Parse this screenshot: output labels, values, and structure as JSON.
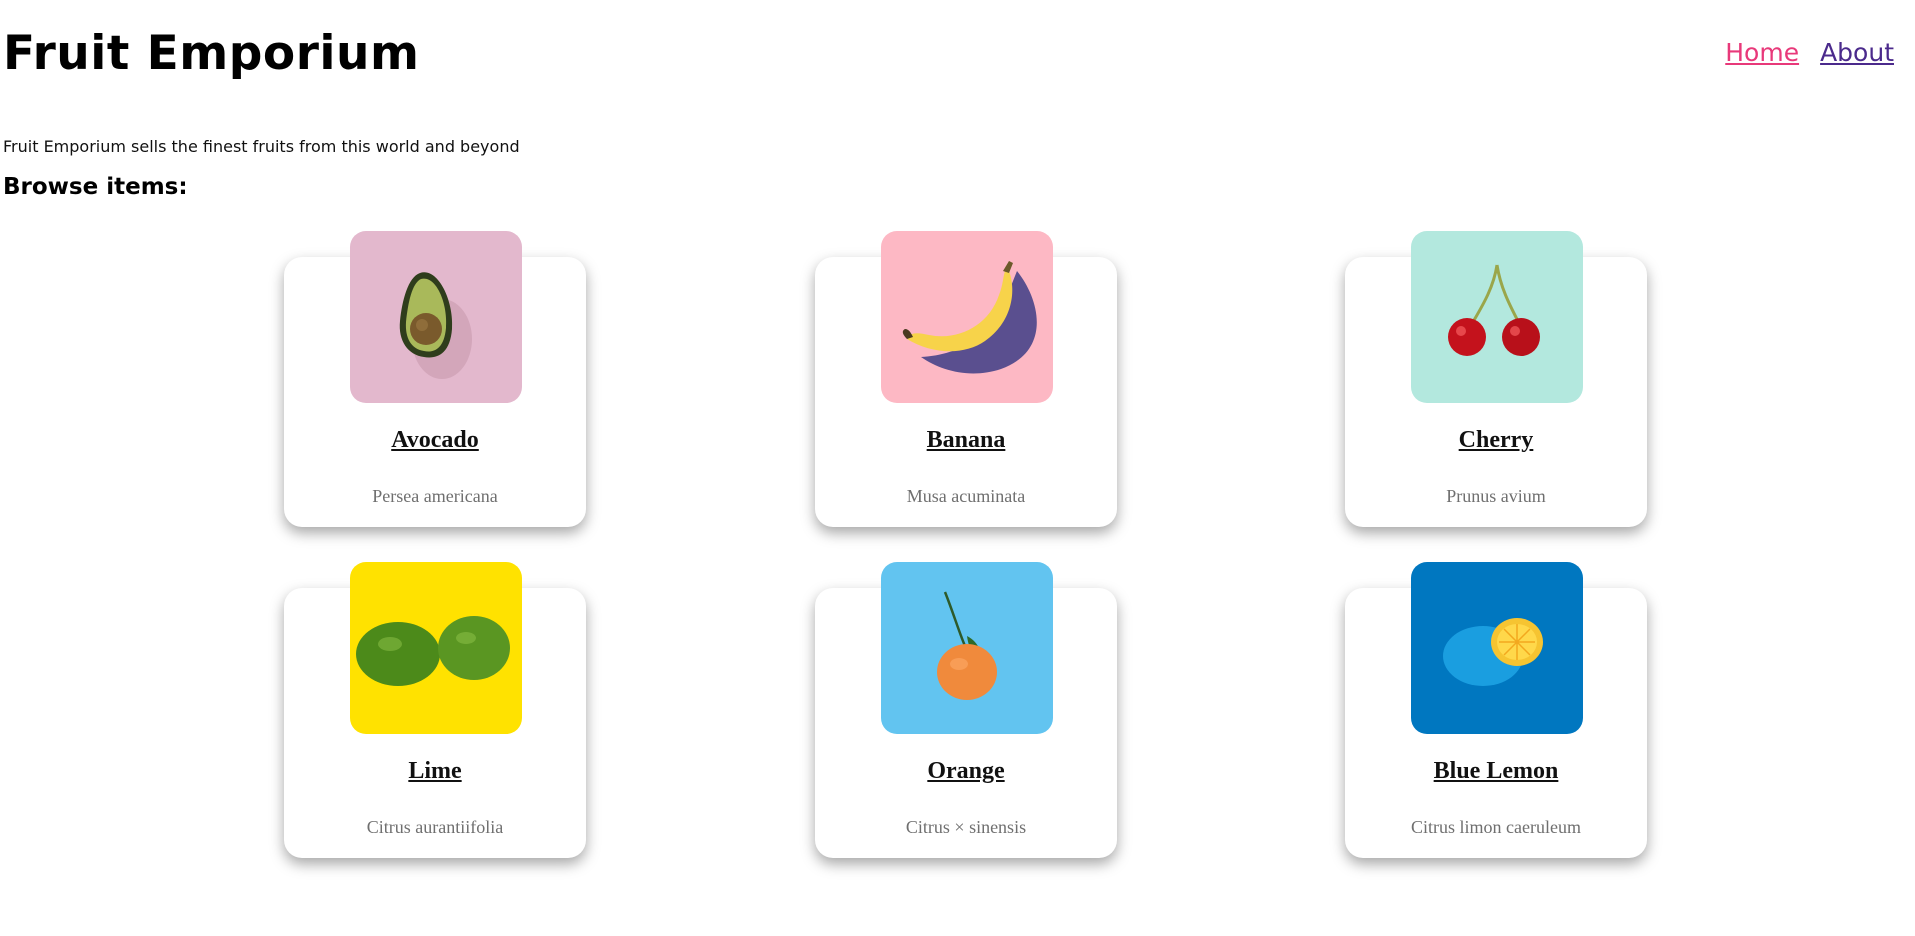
{
  "header": {
    "title": "Fruit Emporium",
    "nav": [
      {
        "label": "Home"
      },
      {
        "label": "About"
      }
    ]
  },
  "intro": {
    "tagline": "Fruit Emporium sells the finest fruits from this world and beyond",
    "browse_heading": "Browse items:"
  },
  "items": [
    {
      "name": "Avocado",
      "scientific": "Persea americana",
      "image_bg": "#e3b8cd"
    },
    {
      "name": "Banana",
      "scientific": "Musa acuminata",
      "image_bg": "#fdb8c4"
    },
    {
      "name": "Cherry",
      "scientific": "Prunus avium",
      "image_bg": "#b3e8de"
    },
    {
      "name": "Lime",
      "scientific": "Citrus aurantiifolia",
      "image_bg": "#ffe200"
    },
    {
      "name": "Orange",
      "scientific": "Citrus × sinensis",
      "image_bg": "#62c4f0"
    },
    {
      "name": "Blue Lemon",
      "scientific": "Citrus limon caeruleum",
      "image_bg": "#0077c0"
    }
  ]
}
